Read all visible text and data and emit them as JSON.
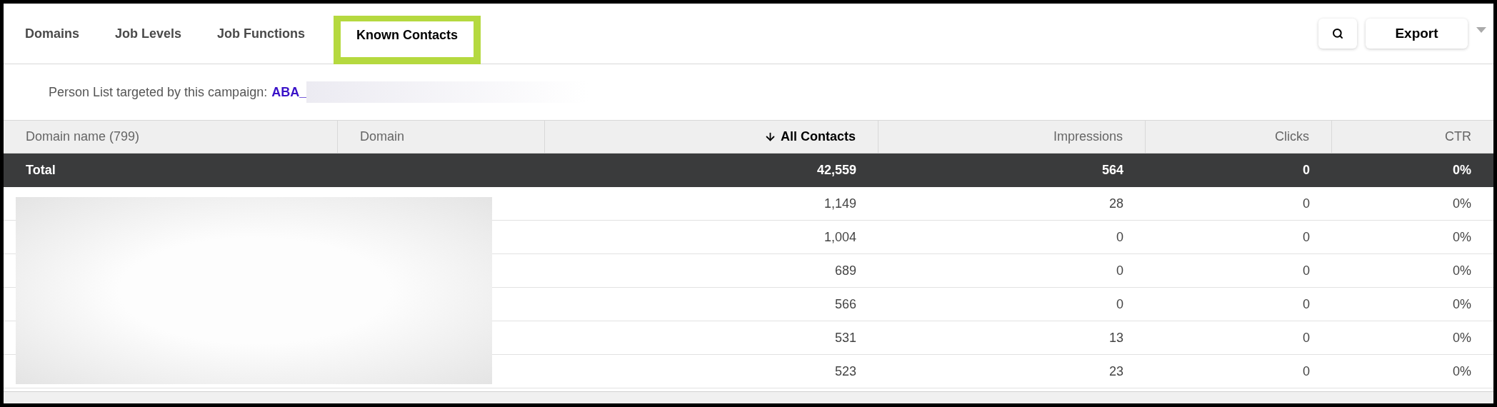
{
  "tabs": [
    {
      "label": "Domains",
      "selected": false
    },
    {
      "label": "Job Levels",
      "selected": false
    },
    {
      "label": "Job Functions",
      "selected": false
    },
    {
      "label": "Known Contacts",
      "selected": true
    }
  ],
  "toolbar": {
    "export_label": "Export"
  },
  "person_list": {
    "label": "Person List targeted by this campaign:",
    "link": "ABA_"
  },
  "table": {
    "columns": [
      {
        "label": "Domain name (799)",
        "sorted": false
      },
      {
        "label": "Domain",
        "sorted": false
      },
      {
        "label": "All Contacts",
        "sorted": true
      },
      {
        "label": "Impressions",
        "sorted": false
      },
      {
        "label": "Clicks",
        "sorted": false
      },
      {
        "label": "CTR",
        "sorted": false
      }
    ],
    "total": {
      "label": "Total",
      "values": [
        "42,559",
        "564",
        "0",
        "0%"
      ]
    },
    "rows": [
      [
        null,
        null,
        "1,149",
        "28",
        "0",
        "0%"
      ],
      [
        null,
        null,
        "1,004",
        "0",
        "0",
        "0%"
      ],
      [
        null,
        null,
        "689",
        "0",
        "0",
        "0%"
      ],
      [
        null,
        null,
        "566",
        "0",
        "0",
        "0%"
      ],
      [
        null,
        null,
        "531",
        "13",
        "0",
        "0%"
      ],
      [
        null,
        null,
        "523",
        "23",
        "0",
        "0%"
      ]
    ]
  }
}
